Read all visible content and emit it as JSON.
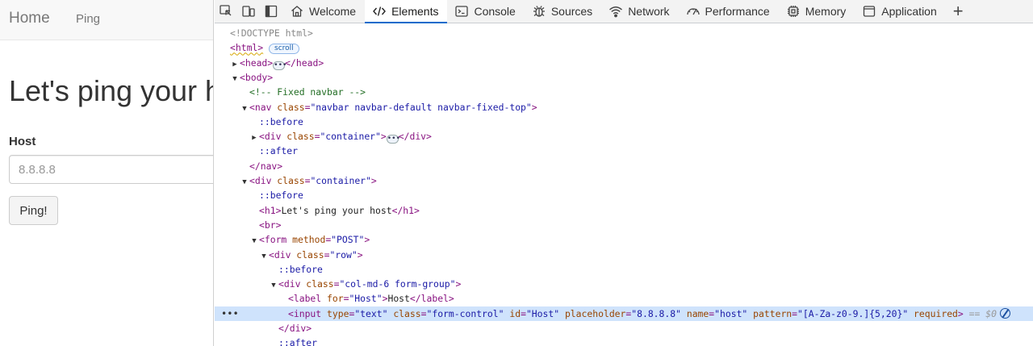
{
  "page": {
    "navbar": {
      "brand": "Home",
      "link_ping": "Ping"
    },
    "heading": "Let's ping your host",
    "form": {
      "host_label": "Host",
      "host_placeholder": "8.8.8.8",
      "ping_button": "Ping!"
    }
  },
  "devtools": {
    "tabs": [
      {
        "label": "Welcome",
        "icon": "home-icon"
      },
      {
        "label": "Elements",
        "icon": "code-icon",
        "active": true
      },
      {
        "label": "Console",
        "icon": "console-icon"
      },
      {
        "label": "Sources",
        "icon": "bug-icon"
      },
      {
        "label": "Network",
        "icon": "wifi-icon"
      },
      {
        "label": "Performance",
        "icon": "gauge-icon"
      },
      {
        "label": "Memory",
        "icon": "chip-icon"
      },
      {
        "label": "Application",
        "icon": "app-window-icon"
      }
    ],
    "scroll_badge": "scroll",
    "dom": {
      "doctype": "<!DOCTYPE html>",
      "html_tag": "html",
      "head_tag": "head",
      "body_tag": "body",
      "comment": "<!-- Fixed navbar -->",
      "nav_tag": "nav",
      "nav_class": "\"navbar navbar-default navbar-fixed-top\"",
      "before": "::before",
      "after": "::after",
      "container_class": "\"container\"",
      "div_tag": "div",
      "h1_text": "Let's ping your host",
      "br_tag": "br",
      "form_tag": "form",
      "form_method": "\"POST\"",
      "row_class": "\"row\"",
      "col_class": "\"col-md-6 form-group\"",
      "label_for": "\"Host\"",
      "label_text": "Host",
      "input_type": "\"text\"",
      "input_class": "\"form-control\"",
      "input_id": "\"Host\"",
      "input_placeholder": "\"8.8.8.8\"",
      "input_name": "\"host\"",
      "input_pattern": "\"[A-Za-z0-9.]{5,20}\"",
      "input_required": "required",
      "selected_marker": "== $0",
      "ellipsis": "•••"
    }
  },
  "colors": {
    "accent": "#0b6bcb",
    "selected_row": "#cfe3fc",
    "tag": "#881280",
    "attr": "#994500",
    "value": "#1a1aa6",
    "comment": "#236e25"
  }
}
